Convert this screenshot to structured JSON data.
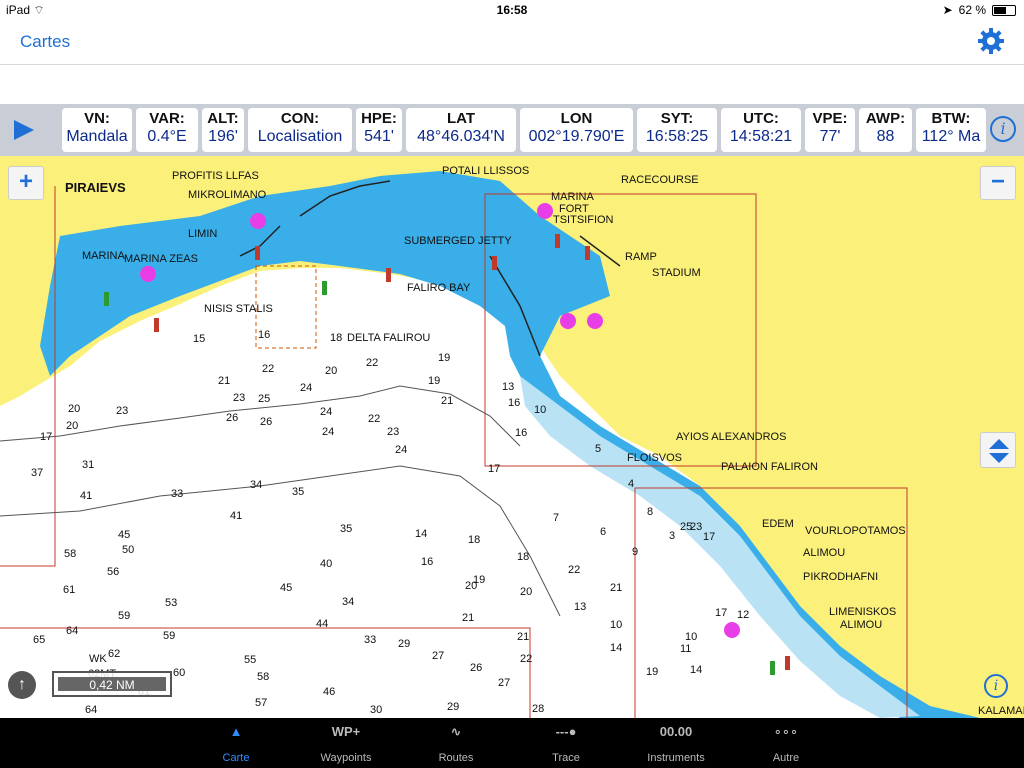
{
  "status": {
    "carrier": "iPad",
    "time": "16:58",
    "battery": "62 %",
    "battery_fraction": 0.62
  },
  "nav": {
    "title": "Cartes"
  },
  "instruments": [
    {
      "label": "VN:",
      "value": "Mandala"
    },
    {
      "label": "VAR:",
      "value": "0.4°E"
    },
    {
      "label": "ALT:",
      "value": "196'"
    },
    {
      "label": "CON:",
      "value": "Localisation"
    },
    {
      "label": "HPE:",
      "value": "541'"
    },
    {
      "label": "LAT",
      "value": "48°46.034'N"
    },
    {
      "label": "LON",
      "value": "002°19.790'E"
    },
    {
      "label": "SYT:",
      "value": "16:58:25"
    },
    {
      "label": "UTC:",
      "value": "14:58:21"
    },
    {
      "label": "VPE:",
      "value": "77'"
    },
    {
      "label": "AWP:",
      "value": "88"
    },
    {
      "label": "BTW:",
      "value": "112° Ma"
    }
  ],
  "map": {
    "labels": [
      "PIRAIEVS",
      "PROFITIS LLFAS",
      "MIKROLIMANO",
      "POTALI LLISSOS",
      "MARINA",
      "FORT",
      "TSITSIFION",
      "RACECOURSE",
      "LIMIN",
      "MARINA",
      "MARINA ZEAS",
      "SUBMERGED JETTY",
      "RAMP",
      "STADIUM",
      "FALIRO BAY",
      "NISIS STALIS",
      "DELTA FALIROU",
      "AYIOS ALEXANDROS",
      "FLOISVOS",
      "PALAION FALIRON",
      "EDEM",
      "VOURLOPOTAMOS",
      "ALIMOU",
      "PIKRODHAFNI",
      "LIMENISKOS",
      "ALIMOU",
      "KALAMAI",
      "WK",
      "62MT"
    ],
    "depths": [
      "15",
      "16",
      "18",
      "19",
      "22",
      "20",
      "21",
      "24",
      "22",
      "23",
      "19",
      "26",
      "25",
      "26",
      "24",
      "21",
      "22",
      "24",
      "23",
      "24",
      "20",
      "23",
      "20",
      "16",
      "13",
      "10",
      "16",
      "31",
      "33",
      "34",
      "35",
      "41",
      "41",
      "45",
      "50",
      "56",
      "58",
      "61",
      "59",
      "53",
      "45",
      "40",
      "35",
      "34",
      "44",
      "33",
      "29",
      "27",
      "21",
      "22",
      "26",
      "27",
      "37",
      "17",
      "14",
      "18",
      "16",
      "19",
      "20",
      "21",
      "55",
      "58",
      "60",
      "57",
      "46",
      "30",
      "29",
      "28",
      "65",
      "64",
      "59",
      "62",
      "64",
      "61",
      "13",
      "14",
      "10",
      "11",
      "9",
      "8",
      "7",
      "6",
      "5",
      "4",
      "3",
      "17",
      "19",
      "12",
      "10",
      "14",
      "17",
      "25",
      "23",
      "22",
      "21",
      "20",
      "18",
      "17"
    ],
    "scale": "0,42 NM",
    "zoom_in": "+",
    "zoom_out": "−"
  },
  "tabs": [
    {
      "icon": "▲",
      "label": "Carte"
    },
    {
      "icon": "WP+",
      "label": "Waypoints"
    },
    {
      "icon": "∿",
      "label": "Routes"
    },
    {
      "icon": "---●",
      "label": "Trace"
    },
    {
      "icon": "00.00",
      "label": "Instruments"
    },
    {
      "icon": "∘∘∘",
      "label": "Autre"
    }
  ],
  "colors": {
    "accent": "#1f6fd6",
    "land": "#fbf07a",
    "water_shallow": "#3aaee8",
    "water_mid": "#b9e3f5"
  }
}
